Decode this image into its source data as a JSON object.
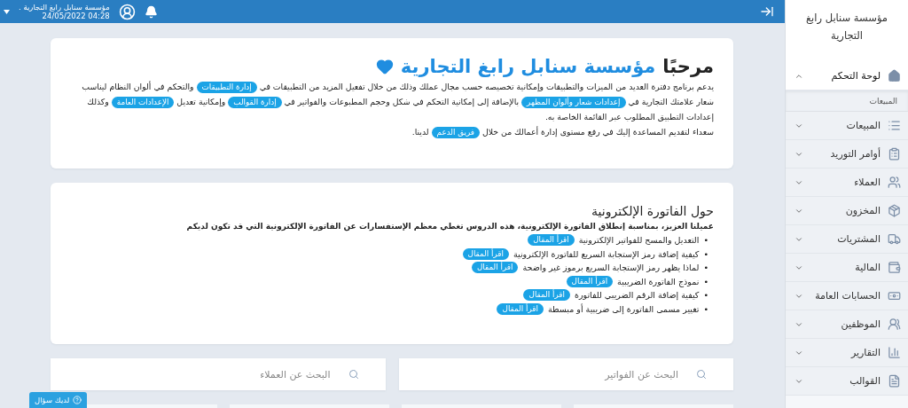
{
  "top_bar": {
    "account_name": "مؤسسة سنابل رابغ التجارية .",
    "datetime": "04:28 24/05/2022"
  },
  "welcome": {
    "greeting": "مرحبًا",
    "company": "مؤسسة سنابل رابغ التجارية",
    "paragraphs": [
      [
        {
          "kind": "text",
          "text": "يدعم برنامج دفترة العديد من الميزات والتطبيقات وإمكانية تخصيصه حسب مجال عملك وذلك من خلال تفعيل المزيد من التطبيقات في "
        },
        {
          "kind": "link",
          "text": "إدارة التطبيقات"
        },
        {
          "kind": "text",
          "text": " والتحكم في ألوان النظام ليناسب شعار علامتك التجارية في "
        },
        {
          "kind": "link",
          "text": "إعدادات شعار وألوان المظهر"
        },
        {
          "kind": "text",
          "text": " بالإضافة إلى إمكانية التحكم في شكل وحجم المطبوعات والفواتير في "
        },
        {
          "kind": "link",
          "text": "إدارة القوالب"
        },
        {
          "kind": "text",
          "text": " وإمكانية تعديل "
        },
        {
          "kind": "link",
          "text": "الإعدادات العامة"
        },
        {
          "kind": "text",
          "text": " وكذلك إعدادات التطبيق المطلوب عبر القائمة الخاصة به."
        }
      ],
      [
        {
          "kind": "text",
          "text": "سعداء لتقديم المساعدة إليك في رفع مستوى إدارة أعمالك من خلال "
        },
        {
          "kind": "link",
          "text": "فريق الدعم"
        },
        {
          "kind": "text",
          "text": " لدينا."
        }
      ]
    ]
  },
  "articles": {
    "title": "حول الفاتورة الإلكترونية",
    "intro": "عميلنا العزيز، بمناسبة إنطلاق الفاتورة الإلكترونية، هذه الدروس تغطي معظم الإستفسارات عن الفاتورة الإلكترونية التي قد تكون لديكم",
    "items": [
      {
        "marker": "•",
        "title": "التعديل والمسح للفواتير الإلكترونية",
        "link": "اقرأ المقال"
      },
      {
        "marker": "•",
        "title": "كيفية إضافة رمز الإستجابة السريع للفاتورة الإلكترونية",
        "link": "اقرأ المقال"
      },
      {
        "marker": "•",
        "title": "لماذا يظهر رمز الإستجابة السريع برموز غير واضحة",
        "link": "اقرأ المقال"
      },
      {
        "marker": "•",
        "title": "نموذج الفاتورة الضريبية",
        "link": "اقرأ المقال"
      },
      {
        "marker": "•",
        "title": "كيفية إضافة الرقم الضريبي للفاتورة",
        "link": "اقرأ المقال"
      },
      {
        "marker": "•",
        "title": "تغيير مسمى الفاتورة إلى ضريبية أو مبسطة",
        "link": "اقرأ المقال"
      }
    ]
  },
  "searches": [
    {
      "placeholder": "البحث عن الفواتير"
    },
    {
      "placeholder": "البحث عن العملاء"
    }
  ],
  "help_button": "لديك سؤال",
  "sidebar": {
    "title": "مؤسسة سنابل رابغ التجارية",
    "items": [
      {
        "label": "لوحة التحكم",
        "selected": true,
        "expanded": true,
        "children": [
          {
            "label": "المبيعات"
          }
        ]
      },
      {
        "label": "المبيعات",
        "selected": false,
        "expanded": false
      },
      {
        "label": "أوامر التوريد",
        "selected": false,
        "expanded": false
      },
      {
        "label": "العملاء",
        "selected": false,
        "expanded": false
      },
      {
        "label": "المخزون",
        "selected": false,
        "expanded": false
      },
      {
        "label": "المشتريات",
        "selected": false,
        "expanded": false
      },
      {
        "label": "المالية",
        "selected": false,
        "expanded": false
      },
      {
        "label": "الحسابات العامة",
        "selected": false,
        "expanded": false
      },
      {
        "label": "الموظفين",
        "selected": false,
        "expanded": false
      },
      {
        "label": "التقارير",
        "selected": false,
        "expanded": false
      },
      {
        "label": "القوالب",
        "selected": false,
        "expanded": false
      }
    ]
  }
}
